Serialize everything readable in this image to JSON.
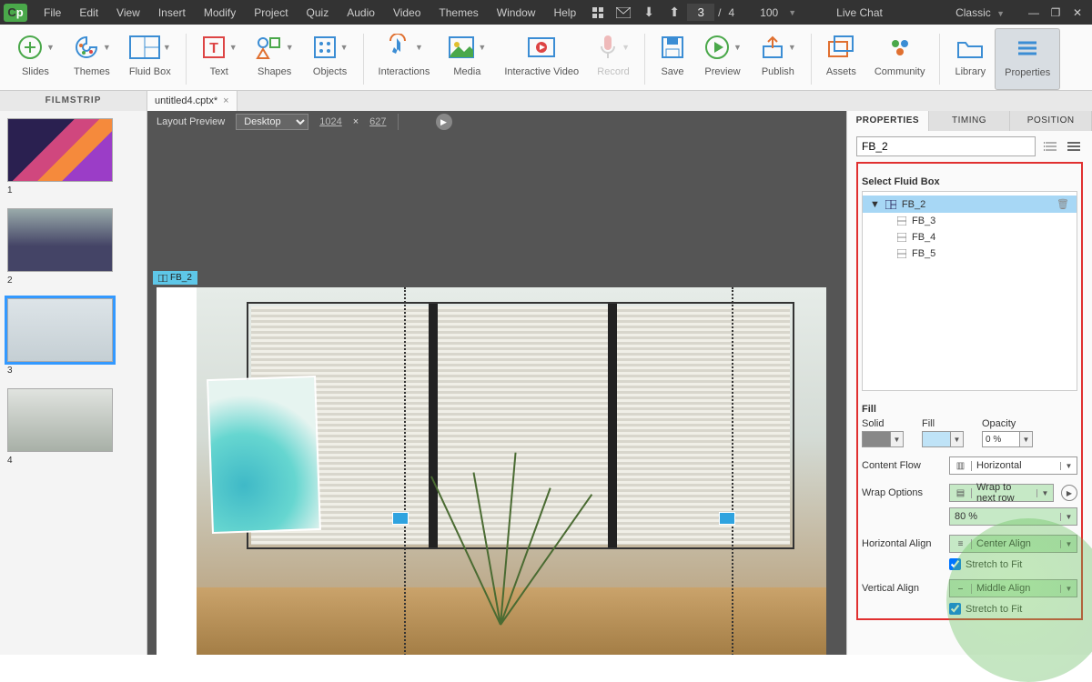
{
  "menu": {
    "items": [
      "File",
      "Edit",
      "View",
      "Insert",
      "Modify",
      "Project",
      "Quiz",
      "Audio",
      "Video",
      "Themes",
      "Window",
      "Help"
    ]
  },
  "pager": {
    "slide": "3",
    "total": "4",
    "zoom": "100"
  },
  "live_chat": "Live Chat",
  "workspace": {
    "selected": "Classic"
  },
  "ribbon": {
    "slides": "Slides",
    "themes": "Themes",
    "fluid": "Fluid Box",
    "text": "Text",
    "shapes": "Shapes",
    "objects": "Objects",
    "interactions": "Interactions",
    "media": "Media",
    "intvideo": "Interactive Video",
    "record": "Record",
    "save": "Save",
    "preview": "Preview",
    "publish": "Publish",
    "assets": "Assets",
    "community": "Community",
    "library": "Library",
    "properties": "Properties"
  },
  "filmstrip_label": "FILMSTRIP",
  "doc_tab": "untitled4.cptx*",
  "layout": {
    "label": "Layout Preview",
    "device": "Desktop",
    "w": "1024",
    "h": "627"
  },
  "slides": [
    "1",
    "2",
    "3",
    "4"
  ],
  "fb_tag": "FB_2",
  "panel": {
    "tabs": [
      "PROPERTIES",
      "TIMING",
      "POSITION"
    ],
    "name": "FB_2",
    "select_label": "Select Fluid Box",
    "tree": {
      "root": "FB_2",
      "children": [
        "FB_3",
        "FB_4",
        "FB_5"
      ]
    },
    "fill_section": "Fill",
    "solid_label": "Solid",
    "fill_label": "Fill",
    "opacity_label": "Opacity",
    "opacity_val": "0 %",
    "content_flow_label": "Content Flow",
    "content_flow": "Horizontal",
    "wrap_label": "Wrap Options",
    "wrap_val": "Wrap to next row",
    "wrap_pct": "80 %",
    "halign_label": "Horizontal Align",
    "halign_val": "Center Align",
    "stretch_label": "Stretch to Fit",
    "valign_label": "Vertical Align",
    "valign_val": "Middle Align"
  }
}
